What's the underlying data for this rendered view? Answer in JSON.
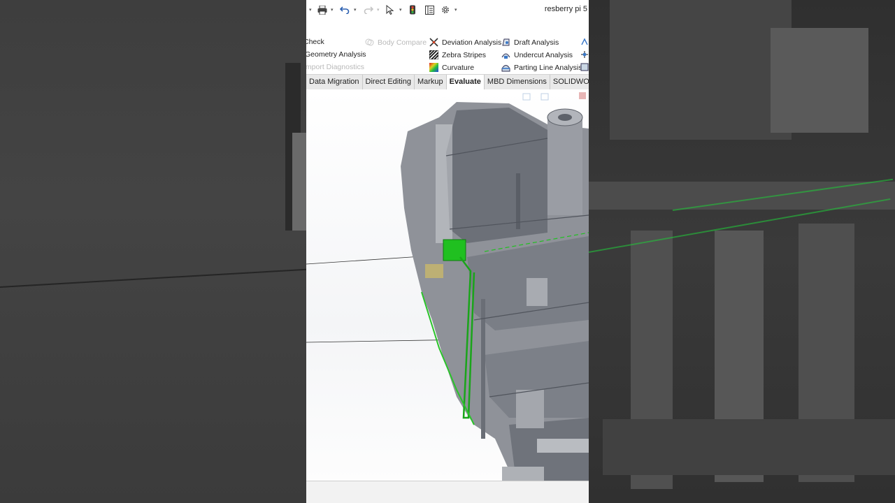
{
  "window": {
    "document_title": "resberry pi 5"
  },
  "quick_access": {
    "icons": [
      "pin-icon",
      "print-icon",
      "undo-icon",
      "redo-icon",
      "select-icon",
      "traffic-light-icon",
      "file-properties-icon",
      "options-gear-icon"
    ]
  },
  "command_manager": {
    "col1": {
      "check": "Check",
      "geometry_analysis": "Geometry Analysis",
      "import_diagnostics": "Import Diagnostics"
    },
    "col2": {
      "body_compare": "Body Compare"
    },
    "col3": {
      "deviation_analysis": "Deviation Analysis",
      "zebra_stripes": "Zebra Stripes",
      "curvature": "Curvature"
    },
    "col4": {
      "draft_analysis": "Draft Analysis",
      "undercut_analysis": "Undercut Analysis",
      "parting_line_analysis": "Parting Line Analysis"
    }
  },
  "tabs": [
    {
      "label": "Data Migration",
      "active": false
    },
    {
      "label": "Direct Editing",
      "active": false
    },
    {
      "label": "Markup",
      "active": false
    },
    {
      "label": "Evaluate",
      "active": true
    },
    {
      "label": "MBD Dimensions",
      "active": false
    },
    {
      "label": "SOLIDWO",
      "active": false
    }
  ],
  "colors": {
    "model_gray": "#8f9299",
    "model_dark": "#6c7078",
    "selection_green": "#20c020",
    "tab_bar": "#e9e9e9"
  }
}
